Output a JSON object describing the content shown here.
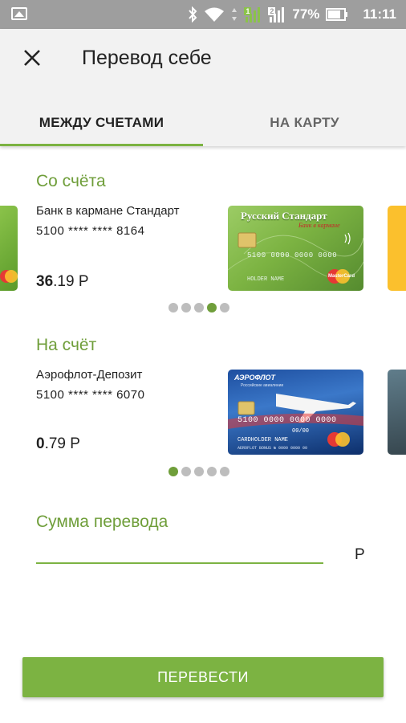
{
  "status_bar": {
    "sim1_label": "1",
    "sim2_label": "2",
    "battery": "77%",
    "time": "11:11"
  },
  "header": {
    "title": "Перевод себе"
  },
  "tabs": [
    {
      "label": "МЕЖДУ СЧЕТАМИ",
      "active": true
    },
    {
      "label": "НА КАРТУ",
      "active": false
    }
  ],
  "from_account": {
    "section_title": "Со счёта",
    "name": "Банк в кармане Стандарт",
    "number": "5100 **** **** 8164",
    "balance_main": "36",
    "balance_fraction": ".19 Р",
    "card": {
      "brand_line1": "Русский Стандарт",
      "brand_line2": "Банк в кармане",
      "number": "5100 0000 0000 0000",
      "holder": "HOLDER NAME",
      "network": "MasterCard"
    },
    "carousel_active_index": 3,
    "carousel_count": 5
  },
  "to_account": {
    "section_title": "На счёт",
    "name": "Аэрофлот-Депозит",
    "number": "5100 **** **** 6070",
    "balance_main": "0",
    "balance_fraction": ".79 Р",
    "card": {
      "brand": "АЭРОФЛОТ",
      "brand_sub": "Российские авиалинии",
      "number": "5100 0000 0000 0000",
      "valid": "00/00",
      "holder": "CARDHOLDER NAME",
      "bonus": "AEROFLOT BONUS № 0000 0000 00",
      "network": "MasterCard"
    },
    "carousel_active_index": 0,
    "carousel_count": 5
  },
  "amount": {
    "label": "Сумма перевода",
    "value": "",
    "currency": "Р"
  },
  "submit_label": "ПЕРЕВЕСТИ",
  "colors": {
    "accent": "#7cb342",
    "accent_text": "#6f9e3a",
    "status_bar": "#9e9e9e",
    "header_bg": "#f2f2f2"
  }
}
